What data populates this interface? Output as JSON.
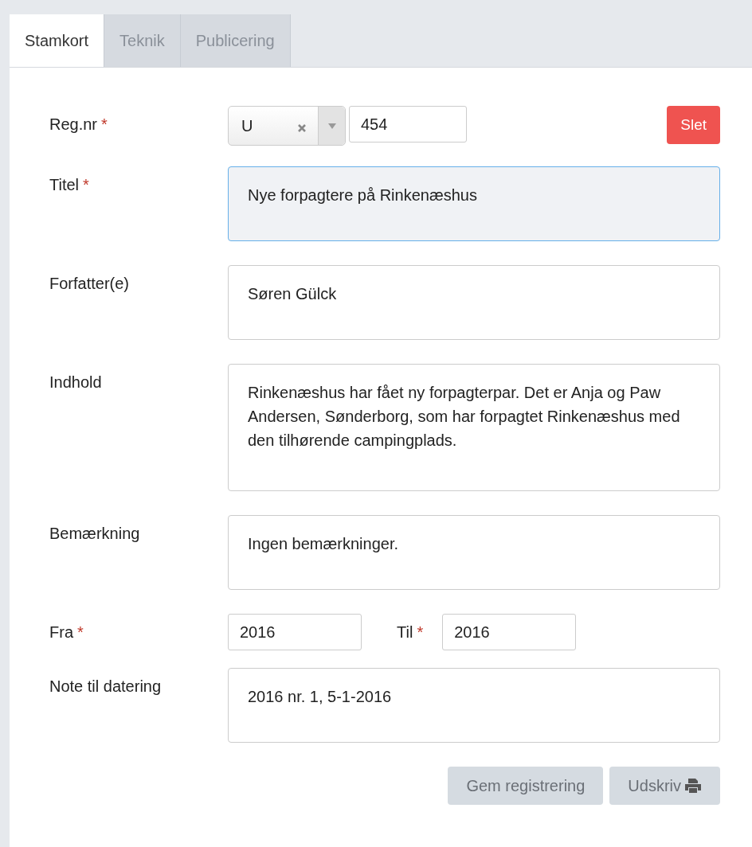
{
  "tabs": [
    {
      "label": "Stamkort",
      "selected": true
    },
    {
      "label": "Teknik",
      "selected": false
    },
    {
      "label": "Publicering",
      "selected": false
    }
  ],
  "reg_nr": {
    "label": "Reg.nr",
    "required_mark": "*",
    "prefix": "U",
    "number": "454",
    "delete_button": "Slet"
  },
  "fields": [
    {
      "label": "Titel",
      "required_mark": "*",
      "value": "Nye forpagtere på Rinkenæshus",
      "focused": true,
      "kind": "textarea"
    },
    {
      "label": "Forfatter(e)",
      "value": "Søren Gülck",
      "focused": false,
      "kind": "textarea"
    },
    {
      "label": "Indhold",
      "value": "Rinkenæshus har fået ny forpagterpar. Det er Anja og Paw Andersen, Sønderborg, som har forpagtet Rinkenæshus med den tilhørende campingplads.",
      "focused": false,
      "kind": "tall"
    },
    {
      "label": "Bemærkning",
      "value": "Ingen bemærkninger.",
      "focused": false,
      "kind": "textarea"
    }
  ],
  "dates": [
    {
      "label": "Fra",
      "required_mark": "*",
      "value": "2016"
    },
    {
      "label": "Til",
      "required_mark": "*",
      "value": "2016"
    }
  ],
  "note": {
    "label": "Note til datering",
    "value": "2016 nr. 1, 5-1-2016"
  },
  "buttons": [
    {
      "label": "Gem registrering",
      "kind": "plain"
    },
    {
      "label": "Udskriv",
      "kind": "print"
    }
  ]
}
